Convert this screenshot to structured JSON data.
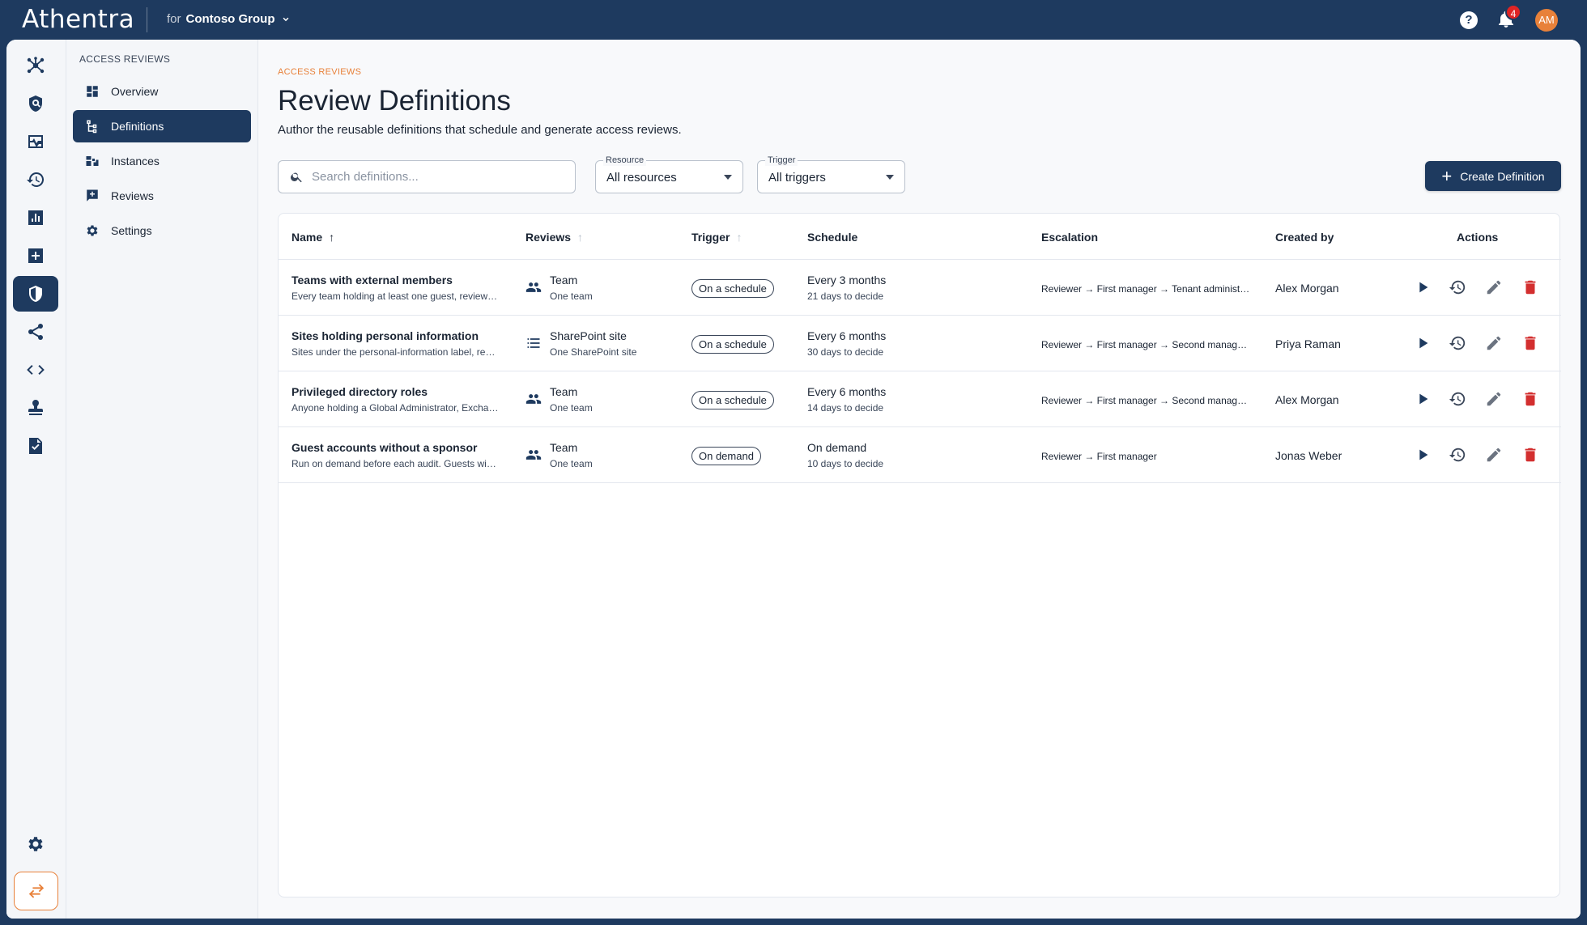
{
  "app": {
    "brand": "Athentra",
    "tenant_prefix": "for",
    "tenant_name": "Contoso Group",
    "notifications_count": "4",
    "avatar_initials": "AM"
  },
  "rail": {
    "items": [
      {
        "name": "graph",
        "icon": "hub-icon"
      },
      {
        "name": "identity-protection",
        "icon": "shield-search-icon"
      },
      {
        "name": "monitoring",
        "icon": "pulse-icon"
      },
      {
        "name": "history",
        "icon": "history-icon"
      },
      {
        "name": "reports",
        "icon": "bar-chart-icon"
      },
      {
        "name": "add",
        "icon": "plus-box-icon"
      },
      {
        "name": "access-reviews",
        "icon": "shield-icon",
        "active": true
      },
      {
        "name": "sharing",
        "icon": "share-icon"
      },
      {
        "name": "developer",
        "icon": "code-icon"
      },
      {
        "name": "approvals",
        "icon": "stamp-icon"
      },
      {
        "name": "compliance",
        "icon": "document-check-icon"
      }
    ],
    "settings_icon": "gear-icon",
    "toggle_icon": "swap-icon"
  },
  "subnav": {
    "title": "ACCESS REVIEWS",
    "items": [
      {
        "label": "Overview",
        "icon": "dashboard-icon"
      },
      {
        "label": "Definitions",
        "icon": "tree-icon",
        "active": true
      },
      {
        "label": "Instances",
        "icon": "instances-icon"
      },
      {
        "label": "Reviews",
        "icon": "review-icon"
      },
      {
        "label": "Settings",
        "icon": "gear-icon"
      }
    ]
  },
  "page": {
    "breadcrumb": "ACCESS REVIEWS",
    "title": "Review Definitions",
    "subtitle": "Author the reusable definitions that schedule and generate access reviews."
  },
  "filters": {
    "search_placeholder": "Search definitions...",
    "resource_label": "Resource",
    "resource_value": "All resources",
    "trigger_label": "Trigger",
    "trigger_value": "All triggers",
    "create_label": "Create Definition"
  },
  "table": {
    "columns": {
      "name": "Name",
      "reviews": "Reviews",
      "trigger": "Trigger",
      "schedule": "Schedule",
      "escalation": "Escalation",
      "created_by": "Created by",
      "actions": "Actions"
    },
    "rows": [
      {
        "name": "Teams with external members",
        "description": "Every team holding at least one guest, reviewed quarterly by owners.",
        "resource_icon": "people-icon",
        "resource": "Team",
        "scope": "One team",
        "trigger": "On a schedule",
        "schedule": "Every 3 months",
        "decide": "21 days to decide",
        "escalation": "Reviewer → First manager → Tenant administrator",
        "created_by": "Alex Morgan"
      },
      {
        "name": "Sites holding personal information",
        "description": "Sites under the personal-information label, reviewed twice a year.",
        "resource_icon": "list-icon",
        "resource": "SharePoint site",
        "scope": "One SharePoint site",
        "trigger": "On a schedule",
        "schedule": "Every 6 months",
        "decide": "30 days to decide",
        "escalation": "Reviewer → First manager → Second manager → Tenant administrator",
        "created_by": "Priya Raman"
      },
      {
        "name": "Privileged directory roles",
        "description": "Anyone holding a Global Administrator, Exchange Administrator role.",
        "resource_icon": "people-icon",
        "resource": "Team",
        "scope": "One team",
        "trigger": "On a schedule",
        "schedule": "Every 6 months",
        "decide": "14 days to decide",
        "escalation": "Reviewer → First manager → Second manager → Tenant administrator",
        "created_by": "Alex Morgan"
      },
      {
        "name": "Guest accounts without a sponsor",
        "description": "Run on demand before each audit. Guests without a sponsor are reviewed.",
        "resource_icon": "people-icon",
        "resource": "Team",
        "scope": "One team",
        "trigger": "On demand",
        "schedule": "On demand",
        "decide": "10 days to decide",
        "escalation": "Reviewer → First manager",
        "created_by": "Jonas Weber"
      }
    ]
  },
  "colors": {
    "primary": "#1e3a5f",
    "accent": "#e8813a",
    "danger": "#d32f2f",
    "badge": "#e02424"
  }
}
